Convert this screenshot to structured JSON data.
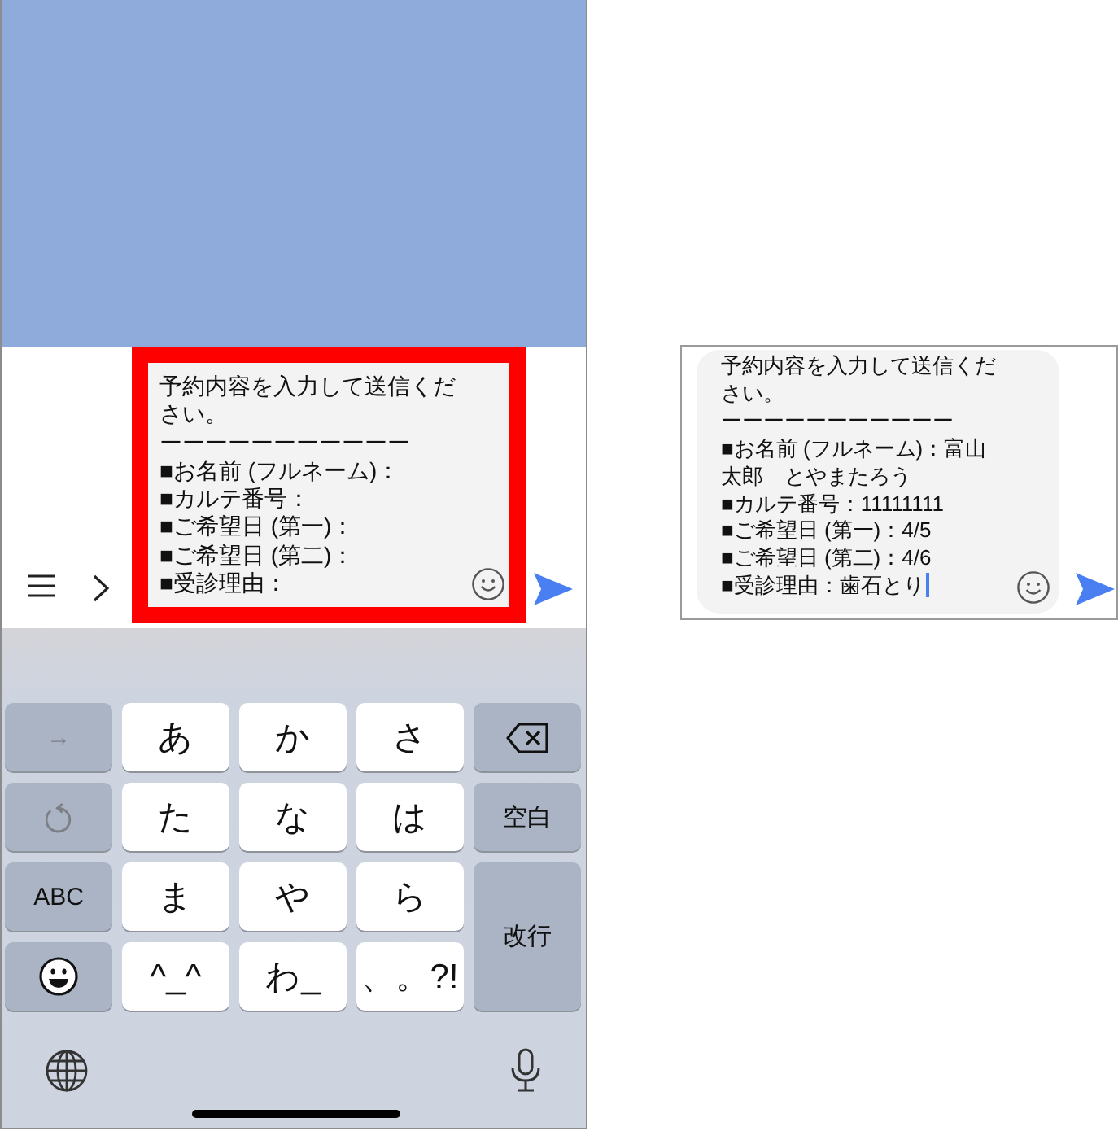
{
  "input_bar": {
    "highlighted": true,
    "message": {
      "focused": false,
      "lines": [
        "予約内容を入力して送信ください。",
        "ーーーーーーーーーーー",
        "■お名前 (フルネーム)：",
        "■カルテ番号：",
        "■ご希望日 (第一)：",
        "■ご希望日 (第二)：",
        "■受診理由："
      ]
    }
  },
  "keyboard": {
    "keys": [
      {
        "kind": "function",
        "label": "→",
        "disabled": true
      },
      {
        "kind": "kana",
        "label": "あ",
        "disabled": false
      },
      {
        "kind": "kana",
        "label": "か",
        "disabled": false
      },
      {
        "kind": "kana",
        "label": "さ",
        "disabled": false
      },
      {
        "kind": "delete",
        "disabled": false
      },
      {
        "kind": "undo",
        "disabled": true
      },
      {
        "kind": "kana",
        "label": "た",
        "disabled": false
      },
      {
        "kind": "kana",
        "label": "な",
        "disabled": false
      },
      {
        "kind": "kana",
        "label": "は",
        "disabled": false
      },
      {
        "kind": "function",
        "label": "空白",
        "disabled": false
      },
      {
        "kind": "function",
        "label": "ABC",
        "disabled": false
      },
      {
        "kind": "kana",
        "label": "ま",
        "disabled": false
      },
      {
        "kind": "kana",
        "label": "や",
        "disabled": false
      },
      {
        "kind": "kana",
        "label": "ら",
        "disabled": false
      },
      {
        "kind": "return",
        "label": "改行",
        "disabled": false
      },
      {
        "kind": "emoji",
        "disabled": false
      },
      {
        "kind": "kana",
        "label": "^_^",
        "disabled": false
      },
      {
        "kind": "kana",
        "label": "わ_",
        "disabled": false
      },
      {
        "kind": "kana",
        "label": "、。?!",
        "disabled": false
      }
    ]
  },
  "preview": {
    "message": {
      "focused": true,
      "lines": [
        "予約内容を入力して送信ください。",
        "ーーーーーーーーーーー",
        "■お名前 (フルネーム)：富山太郎　とやまたろう",
        "■カルテ番号：11111111",
        "■ご希望日 (第一)：4/5",
        "■ご希望日 (第二)：4/6",
        "■受診理由：歯石とり"
      ]
    }
  }
}
